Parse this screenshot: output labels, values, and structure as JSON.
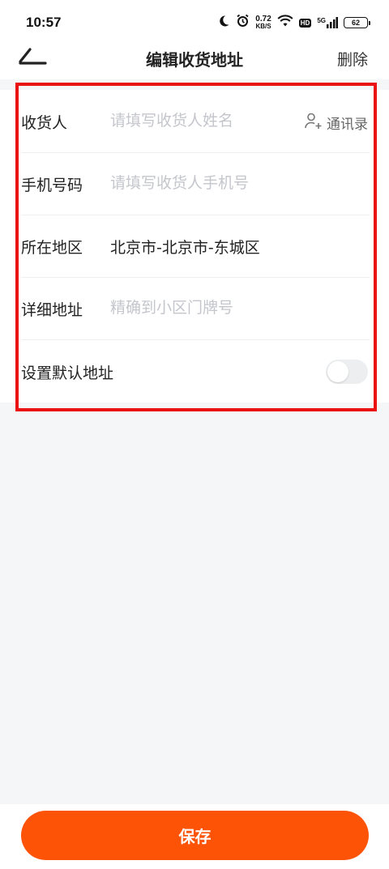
{
  "status_bar": {
    "time": "10:57",
    "net_speed_value": "0.72",
    "net_speed_unit": "KB/S",
    "hd_label": "HD",
    "network_label": "5G",
    "battery": "62"
  },
  "nav": {
    "title": "编辑收货地址",
    "delete_label": "删除"
  },
  "form": {
    "receiver": {
      "label": "收货人",
      "placeholder": "请填写收货人姓名",
      "value": ""
    },
    "contacts_label": "通讯录",
    "phone": {
      "label": "手机号码",
      "placeholder": "请填写收货人手机号",
      "value": ""
    },
    "region": {
      "label": "所在地区",
      "value": "北京市-北京市-东城区"
    },
    "detail": {
      "label": "详细地址",
      "placeholder": "精确到小区门牌号",
      "value": ""
    },
    "default": {
      "label": "设置默认地址",
      "enabled": false
    }
  },
  "footer": {
    "save_label": "保存"
  },
  "colors": {
    "accent": "#fd5307",
    "highlight": "#ea1212",
    "placeholder": "#c4c6cc",
    "background": "#f5f6f8"
  }
}
